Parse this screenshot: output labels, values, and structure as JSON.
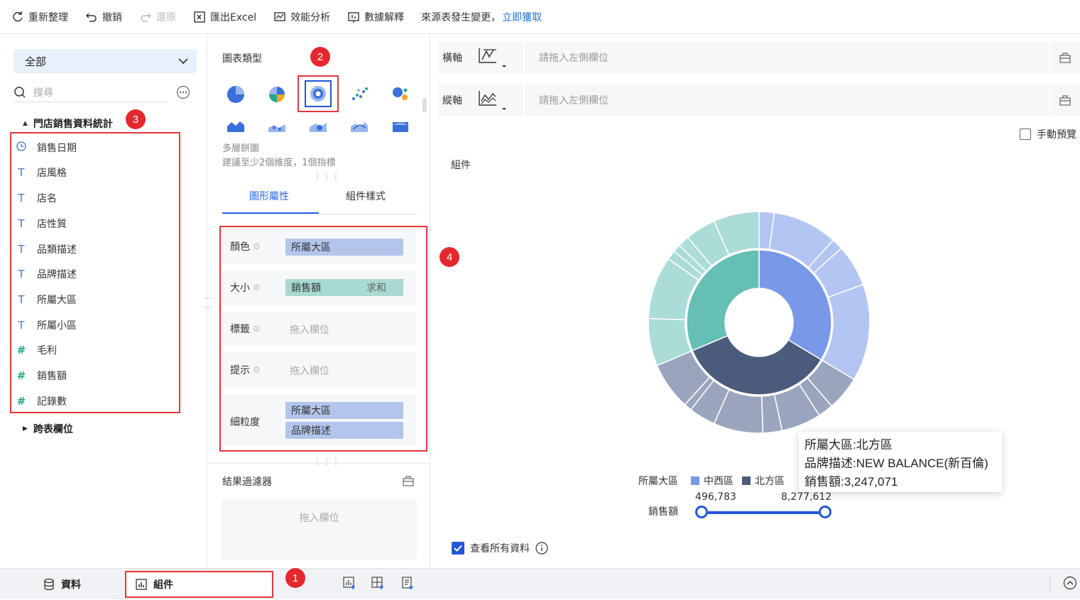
{
  "toolbar": {
    "refresh": "重新整理",
    "undo": "撤銷",
    "redo": "還原",
    "export": "匯出Excel",
    "perf": "效能分析",
    "explain": "數據解釋",
    "notice": "來源表發生變更，",
    "notice_link": "立即獲取"
  },
  "left": {
    "select": "全部",
    "search_placeholder": "搜尋",
    "dataset": "門店銷售資料統計",
    "fields": [
      {
        "icon": "clock-icon",
        "label": "銷售日期"
      },
      {
        "icon": "text-icon",
        "label": "店風格"
      },
      {
        "icon": "text-icon",
        "label": "店名"
      },
      {
        "icon": "text-icon",
        "label": "店性質"
      },
      {
        "icon": "text-icon",
        "label": "品類描述"
      },
      {
        "icon": "text-icon",
        "label": "品牌描述"
      },
      {
        "icon": "text-icon",
        "label": "所屬大區"
      },
      {
        "icon": "text-icon",
        "label": "所屬小區"
      },
      {
        "icon": "number-icon",
        "label": "毛利"
      },
      {
        "icon": "number-icon",
        "label": "銷售額"
      },
      {
        "icon": "number-icon",
        "label": "記錄數"
      }
    ],
    "cross": "跨表欄位"
  },
  "badges": [
    "1",
    "2",
    "3",
    "4"
  ],
  "mid": {
    "chart_type_title": "圖表類型",
    "chart_name": "多層餅圖",
    "chart_hint": "建議至少2個維度，1個指標",
    "tab_shape": "圖形屬性",
    "tab_style": "組件樣式",
    "props": {
      "color_label": "顏色",
      "color_value": "所屬大區",
      "size_label": "大小",
      "size_value": "銷售額",
      "size_agg": "求和",
      "tag_label": "標籤",
      "tip_label": "提示",
      "drop_placeholder": "拖入欄位",
      "grain_label": "細粒度",
      "grain_values": [
        "所屬大區",
        "品牌描述"
      ]
    },
    "filter_title": "結果過濾器",
    "filter_placeholder": "拖入欄位"
  },
  "right": {
    "x_axis": "橫軸",
    "y_axis": "縱軸",
    "axis_placeholder": "請拖入左側欄位",
    "manual_preview": "手動預覽",
    "component_title": "組件",
    "legend_title": "所屬大區",
    "legend": [
      {
        "name": "中西區",
        "color": "#7a98e8"
      },
      {
        "name": "北方區",
        "color": "#4a5b7c"
      }
    ],
    "size_label": "銷售額",
    "range_min": "496,783",
    "range_max": "8,277,612",
    "tooltip": {
      "line1": "所屬大區:北方區",
      "line2": "品牌描述:NEW BALANCE(新百倫)",
      "line3": "銷售額:3,247,071"
    },
    "view_all": "查看所有資料"
  },
  "bottom": {
    "data_tab": "資料",
    "component_tab": "組件"
  },
  "colors": {
    "accent": "#2457d6",
    "highlight": "#e0383e"
  }
}
